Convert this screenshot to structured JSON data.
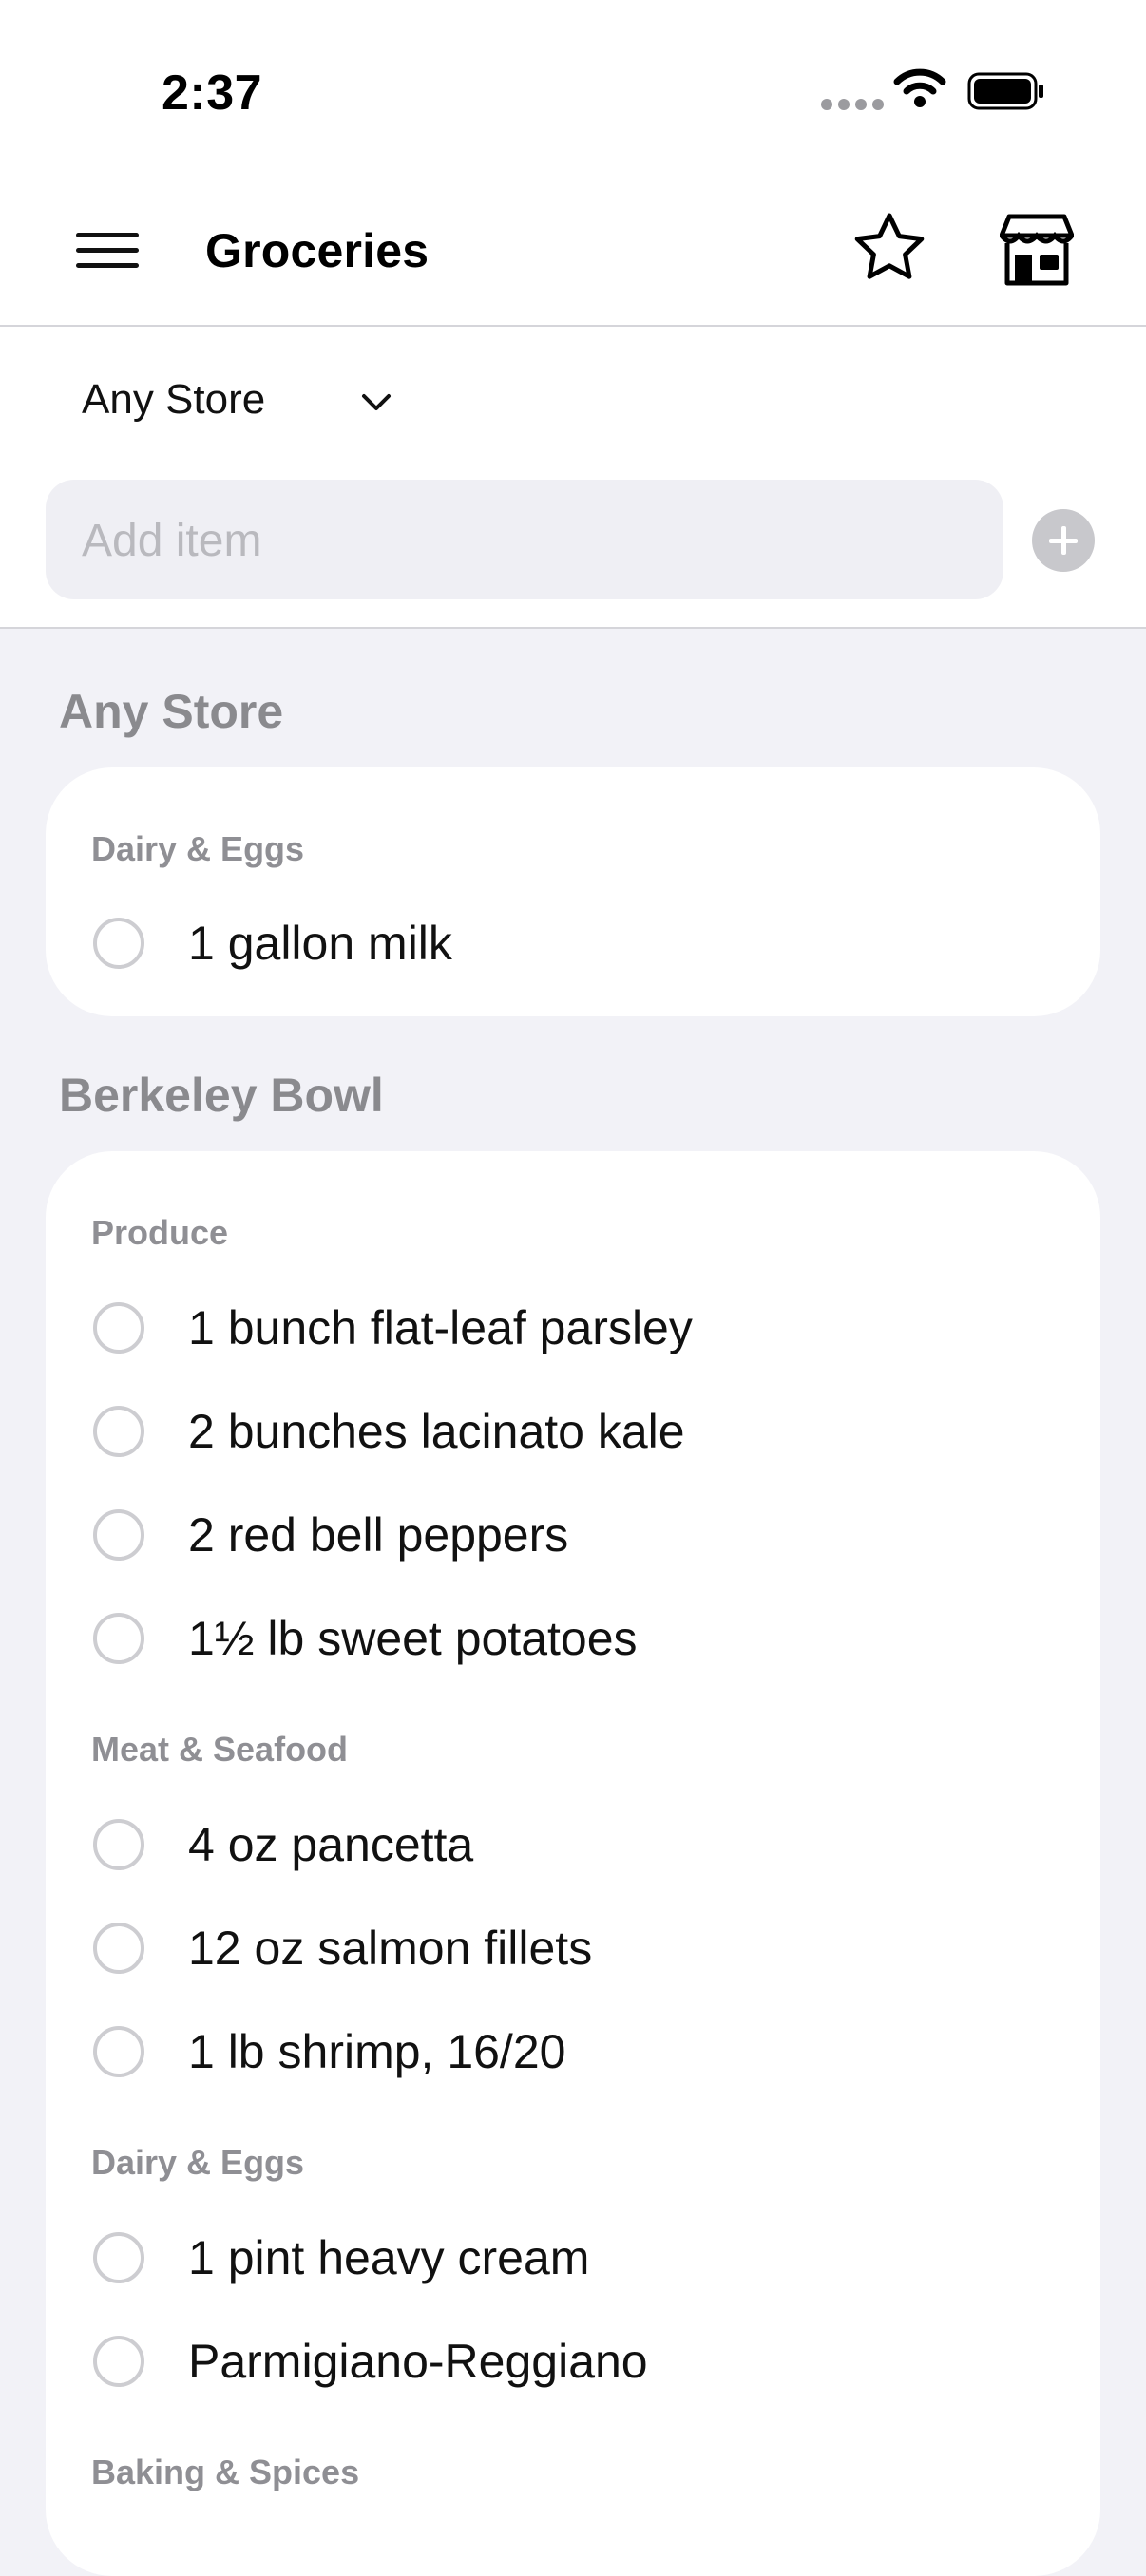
{
  "status_bar": {
    "time": "2:37"
  },
  "header": {
    "title": "Groceries"
  },
  "store_picker": {
    "label": "Any Store"
  },
  "add_item": {
    "placeholder": "Add item"
  },
  "sections": [
    {
      "title": "Any Store",
      "categories": [
        {
          "name": "Dairy & Eggs",
          "items": [
            "1 gallon milk"
          ]
        }
      ]
    },
    {
      "title": "Berkeley Bowl",
      "categories": [
        {
          "name": "Produce",
          "items": [
            "1 bunch flat-leaf parsley",
            "2 bunches lacinato kale",
            "2 red bell peppers",
            "1½ lb sweet potatoes"
          ]
        },
        {
          "name": "Meat & Seafood",
          "items": [
            "4 oz pancetta",
            "12 oz salmon fillets",
            "1 lb shrimp, 16/20"
          ]
        },
        {
          "name": "Dairy & Eggs",
          "items": [
            "1 pint heavy cream",
            "Parmigiano-Reggiano"
          ]
        },
        {
          "name": "Baking & Spices",
          "items": []
        }
      ]
    }
  ]
}
